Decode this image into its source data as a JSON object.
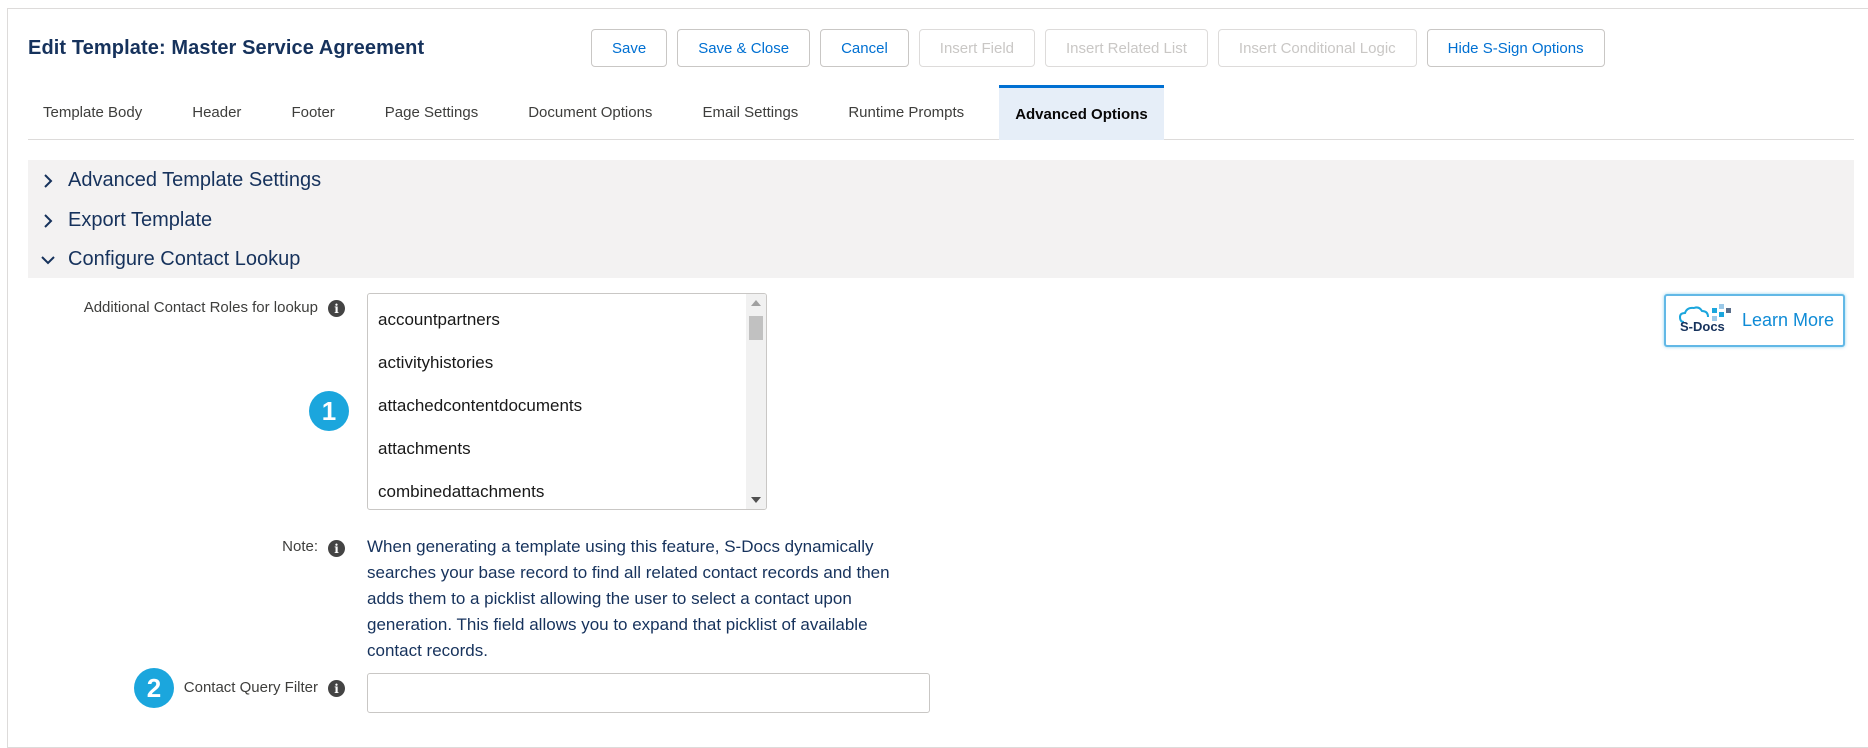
{
  "page": {
    "title": "Edit Template: Master Service Agreement"
  },
  "toolbar": {
    "buttons": [
      {
        "label": "Save",
        "enabled": true
      },
      {
        "label": "Save & Close",
        "enabled": true
      },
      {
        "label": "Cancel",
        "enabled": true
      },
      {
        "label": "Insert Field",
        "enabled": false
      },
      {
        "label": "Insert Related List",
        "enabled": false
      },
      {
        "label": "Insert Conditional Logic",
        "enabled": false
      },
      {
        "label": "Hide S-Sign Options",
        "enabled": true
      }
    ]
  },
  "tabs": [
    {
      "label": "Template Body",
      "active": false
    },
    {
      "label": "Header",
      "active": false
    },
    {
      "label": "Footer",
      "active": false
    },
    {
      "label": "Page Settings",
      "active": false
    },
    {
      "label": "Document Options",
      "active": false
    },
    {
      "label": "Email Settings",
      "active": false
    },
    {
      "label": "Runtime Prompts",
      "active": false
    },
    {
      "label": "Advanced Options",
      "active": true
    }
  ],
  "sections": [
    {
      "label": "Advanced Template Settings",
      "expanded": false
    },
    {
      "label": "Export Template",
      "expanded": false
    },
    {
      "label": "Configure Contact Lookup",
      "expanded": true
    }
  ],
  "contact_lookup": {
    "roles_label": "Additional Contact Roles for lookup",
    "roles_options": [
      "accountpartners",
      "activityhistories",
      "attachedcontentdocuments",
      "attachments",
      "combinedattachments"
    ],
    "note_label": "Note:",
    "note_text": "When generating a template using this feature, S-Docs dynamically searches your base record to find all related contact records and then adds them to a picklist allowing the user to select a contact upon generation. This field allows you to expand that picklist of available contact records.",
    "filter_label": "Contact Query Filter",
    "filter_value": ""
  },
  "badges": {
    "step1": "1",
    "step2": "2"
  },
  "learn_more": {
    "label": "Learn More",
    "logo_text": "S-Docs"
  },
  "icons": {
    "info": "info-icon",
    "chevron_right": "chevron-right-icon",
    "chevron_down": "chevron-down-icon"
  },
  "colors": {
    "accent": "#0070d2",
    "badge": "#1ba6dd",
    "text_dark": "#16325c",
    "band": "#f3f2f2"
  }
}
